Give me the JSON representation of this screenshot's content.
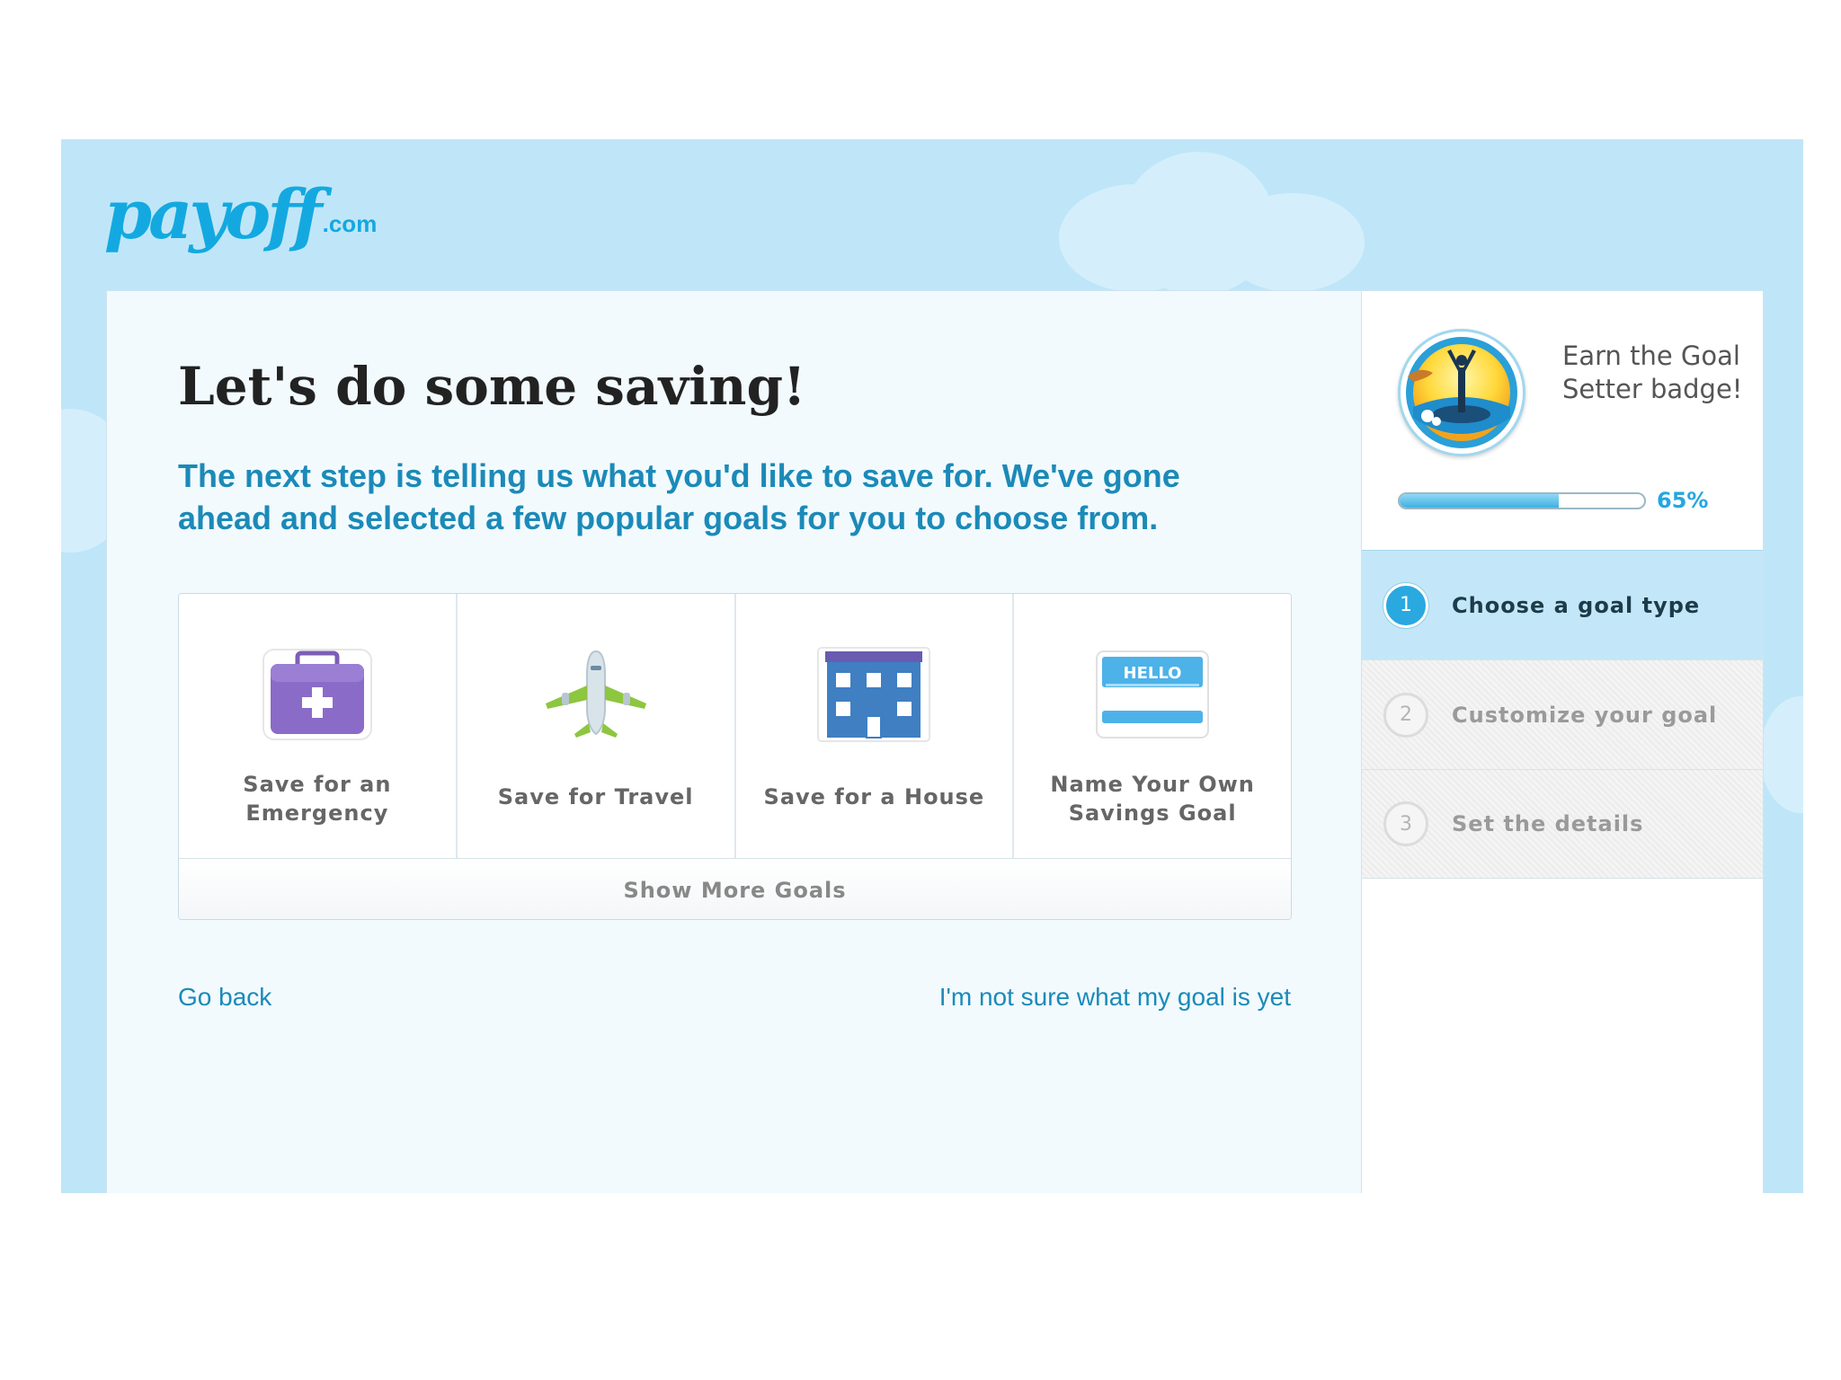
{
  "brand": {
    "logo_main": "payoff",
    "logo_tld": ".com"
  },
  "main": {
    "title": "Let's do some saving!",
    "intro": "The next step is telling us what you'd like to save for. We've gone ahead and selected a few popular goals for you to choose from.",
    "goals": [
      {
        "label": "Save for an\nEmergency",
        "icon": "first-aid-kit-icon"
      },
      {
        "label": "Save for Travel",
        "icon": "airplane-icon"
      },
      {
        "label": "Save for a House",
        "icon": "building-icon"
      },
      {
        "label": "Name Your Own\nSavings Goal",
        "icon": "hello-name-tag-icon",
        "tag_text": "HELLO"
      }
    ],
    "show_more": "Show More Goals",
    "go_back": "Go back",
    "not_sure": "I'm not sure what my goal is yet"
  },
  "sidebar": {
    "badge_text": "Earn the Goal Setter badge!",
    "progress_percent": 65,
    "progress_label": "65%",
    "steps": [
      {
        "num": "1",
        "label": "Choose a goal type",
        "state": "active"
      },
      {
        "num": "2",
        "label": "Customize your goal",
        "state": "inactive"
      },
      {
        "num": "3",
        "label": "Set the details",
        "state": "inactive"
      }
    ]
  },
  "colors": {
    "accent": "#1b8ab8",
    "brand": "#13a9e0",
    "sky": "#bfe6f8",
    "progress": "#23a7e0"
  }
}
